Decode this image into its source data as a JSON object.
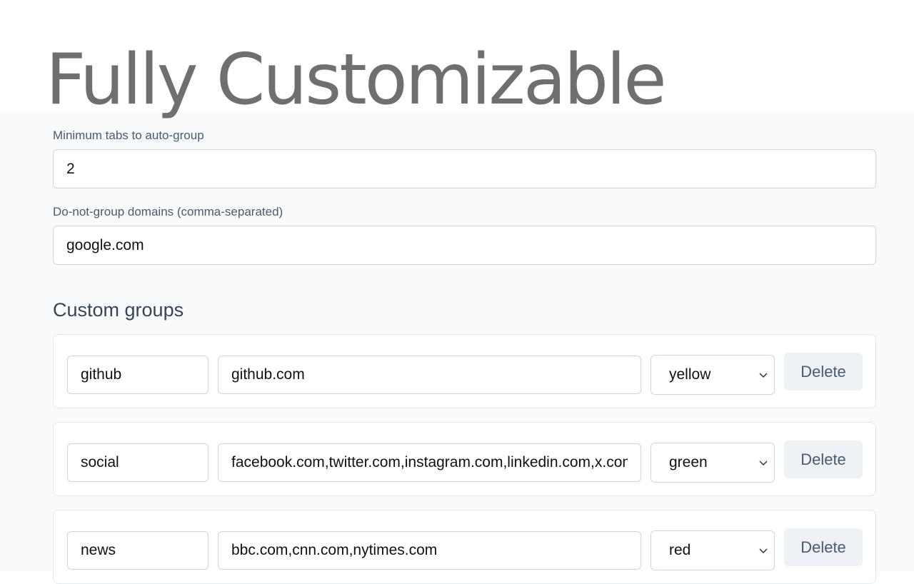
{
  "hero": {
    "title": "Fully Customizable"
  },
  "settings": {
    "min_tabs": {
      "label": "Minimum tabs to auto-group",
      "value": "2"
    },
    "exclude_domains": {
      "label": "Do-not-group domains (comma-separated)",
      "value": "google.com"
    }
  },
  "custom_groups": {
    "title": "Custom groups",
    "delete_label": "Delete",
    "items": [
      {
        "name": "github",
        "domains": "github.com",
        "color": "yellow"
      },
      {
        "name": "social",
        "domains": "facebook.com,twitter.com,instagram.com,linkedin.com,x.com",
        "color": "green"
      },
      {
        "name": "news",
        "domains": "bbc.com,cnn.com,nytimes.com",
        "color": "red"
      }
    ]
  },
  "icons": {
    "select_chevron": "chevron-down-icon"
  }
}
